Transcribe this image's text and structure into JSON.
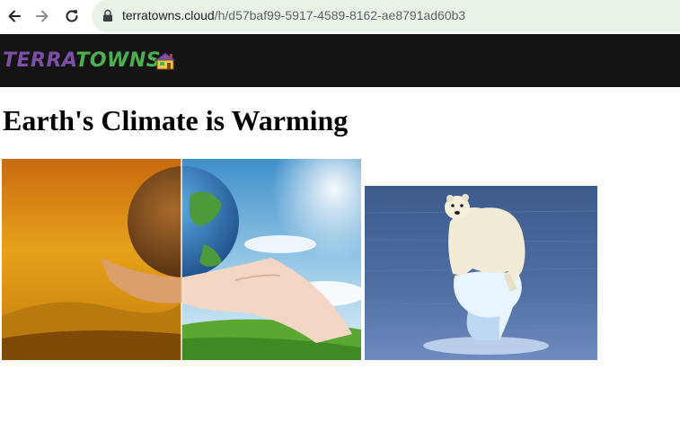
{
  "browser": {
    "url_host": "terratowns.cloud",
    "url_path": "/h/d57baf99-5917-4589-8162-ae8791ad60b3"
  },
  "site": {
    "logo_part1": "TERRA",
    "logo_part2": "TOWNS",
    "logo_icon": "house-icon"
  },
  "main": {
    "title": "Earth's Climate is Warming"
  },
  "icons": {
    "back": "arrow-left-icon",
    "forward": "arrow-right-icon",
    "reload": "reload-icon",
    "lock": "lock-icon"
  },
  "colors": {
    "header_bg": "#141414",
    "logo_terra": "#7b4fa8",
    "logo_towns": "#4caf50",
    "omnibox_bg": "#e8f3e8"
  }
}
